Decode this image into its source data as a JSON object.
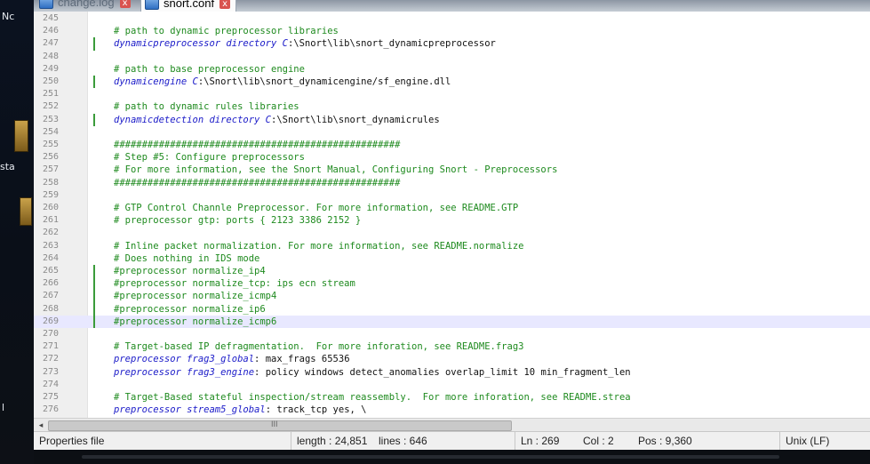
{
  "desktop": {
    "top_label": "Nc",
    "side_label": "sta",
    "bottom_label": "l"
  },
  "tabs": [
    {
      "label": "change.log",
      "close": "x"
    },
    {
      "label": "snort.conf",
      "close": "x"
    }
  ],
  "lines": [
    {
      "num": "245",
      "segments": []
    },
    {
      "num": "246",
      "segments": [
        {
          "text": "# path to dynamic preprocessor libraries",
          "cls": "c-comment"
        }
      ]
    },
    {
      "num": "247",
      "mark": true,
      "segments": [
        {
          "text": "dynamicpreprocessor directory C",
          "cls": "c-key"
        },
        {
          "text": ":\\Snort\\lib\\snort_dynamicpreprocessor",
          "cls": "c-text"
        }
      ]
    },
    {
      "num": "248",
      "segments": []
    },
    {
      "num": "249",
      "segments": [
        {
          "text": "# path to base preprocessor engine",
          "cls": "c-comment"
        }
      ]
    },
    {
      "num": "250",
      "mark": true,
      "segments": [
        {
          "text": "dynamicengine C",
          "cls": "c-key"
        },
        {
          "text": ":\\Snort\\lib\\snort_dynamicengine/sf_engine.dll",
          "cls": "c-text"
        }
      ]
    },
    {
      "num": "251",
      "segments": []
    },
    {
      "num": "252",
      "segments": [
        {
          "text": "# path to dynamic rules libraries",
          "cls": "c-comment"
        }
      ]
    },
    {
      "num": "253",
      "mark": true,
      "segments": [
        {
          "text": "dynamicdetection directory C",
          "cls": "c-key"
        },
        {
          "text": ":\\Snort\\lib\\snort_dynamicrules",
          "cls": "c-text"
        }
      ]
    },
    {
      "num": "254",
      "segments": []
    },
    {
      "num": "255",
      "segments": [
        {
          "text": "###################################################",
          "cls": "c-comment"
        }
      ]
    },
    {
      "num": "256",
      "segments": [
        {
          "text": "# Step #5: Configure preprocessors",
          "cls": "c-comment"
        }
      ]
    },
    {
      "num": "257",
      "segments": [
        {
          "text": "# For more information, see the Snort Manual, Configuring Snort - Preprocessors",
          "cls": "c-comment"
        }
      ]
    },
    {
      "num": "258",
      "segments": [
        {
          "text": "###################################################",
          "cls": "c-comment"
        }
      ]
    },
    {
      "num": "259",
      "segments": []
    },
    {
      "num": "260",
      "segments": [
        {
          "text": "# GTP Control Channle Preprocessor. For more information, see README.GTP",
          "cls": "c-comment"
        }
      ]
    },
    {
      "num": "261",
      "segments": [
        {
          "text": "# preprocessor gtp: ports { 2123 3386 2152 }",
          "cls": "c-comment"
        }
      ]
    },
    {
      "num": "262",
      "segments": []
    },
    {
      "num": "263",
      "segments": [
        {
          "text": "# Inline packet normalization. For more information, see README.normalize",
          "cls": "c-comment"
        }
      ]
    },
    {
      "num": "264",
      "segments": [
        {
          "text": "# Does nothing in IDS mode",
          "cls": "c-comment"
        }
      ]
    },
    {
      "num": "265",
      "mark": true,
      "segments": [
        {
          "text": "#preprocessor normalize_ip4",
          "cls": "c-comment"
        }
      ]
    },
    {
      "num": "266",
      "mark": true,
      "segments": [
        {
          "text": "#preprocessor normalize_tcp: ips ecn stream",
          "cls": "c-comment"
        }
      ]
    },
    {
      "num": "267",
      "mark": true,
      "segments": [
        {
          "text": "#preprocessor normalize_icmp4",
          "cls": "c-comment"
        }
      ]
    },
    {
      "num": "268",
      "mark": true,
      "segments": [
        {
          "text": "#preprocessor normalize_ip6",
          "cls": "c-comment"
        }
      ]
    },
    {
      "num": "269",
      "mark": true,
      "current": true,
      "segments": [
        {
          "text": "#preprocessor normalize_icmp6",
          "cls": "c-comment"
        }
      ]
    },
    {
      "num": "270",
      "segments": []
    },
    {
      "num": "271",
      "segments": [
        {
          "text": "# Target-based IP defragmentation.  For more inforation, see README.frag3",
          "cls": "c-comment"
        }
      ]
    },
    {
      "num": "272",
      "segments": [
        {
          "text": "preprocessor frag3_global",
          "cls": "c-key"
        },
        {
          "text": ": max_frags 65536",
          "cls": "c-text"
        }
      ]
    },
    {
      "num": "273",
      "segments": [
        {
          "text": "preprocessor frag3_engine",
          "cls": "c-key"
        },
        {
          "text": ": policy windows detect_anomalies overlap_limit 10 min_fragment_len",
          "cls": "c-text"
        }
      ]
    },
    {
      "num": "274",
      "segments": []
    },
    {
      "num": "275",
      "segments": [
        {
          "text": "# Target-Based stateful inspection/stream reassembly.  For more inforation, see README.strea",
          "cls": "c-comment"
        }
      ]
    },
    {
      "num": "276",
      "segments": [
        {
          "text": "preprocessor stream5_global",
          "cls": "c-key"
        },
        {
          "text": ": track_tcp yes, \\",
          "cls": "c-text"
        }
      ]
    }
  ],
  "scrollbar": {
    "left_arrow": "◂",
    "grip": "III"
  },
  "status": {
    "file_type": "Properties file",
    "length": "length : 24,851",
    "lines": "lines : 646",
    "ln": "Ln : 269",
    "col": "Col : 2",
    "pos": "Pos : 9,360",
    "eol": "Unix (LF)"
  },
  "colors": {
    "comment": "#1e8a1e",
    "keyword": "#1a1ac8",
    "change_mark": "#3a9b3a",
    "current_line": "#e8e8ff"
  }
}
